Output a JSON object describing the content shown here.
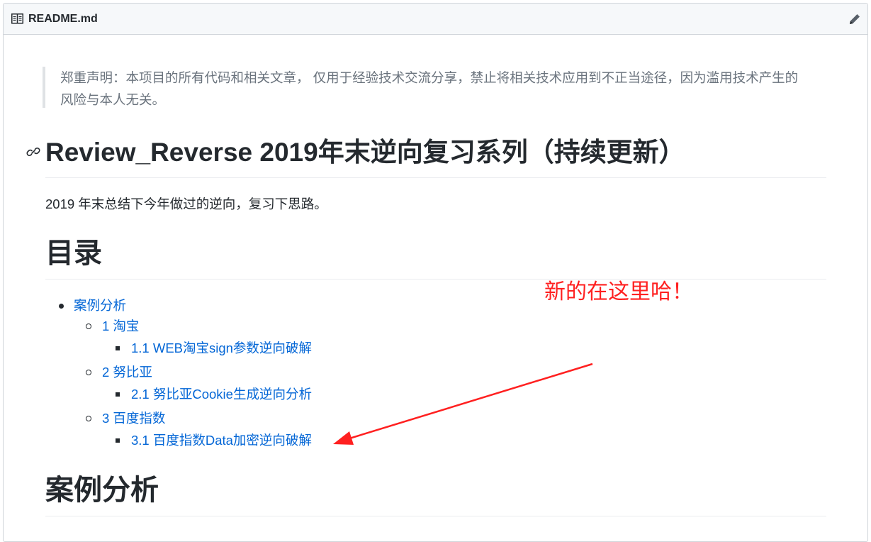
{
  "header": {
    "file_name": "README.md",
    "icon": "book-icon",
    "edit_icon": "pencil-icon"
  },
  "notice": "郑重声明：本项目的所有代码和相关文章， 仅用于经验技术交流分享，禁止将相关技术应用到不正当途径，因为滥用技术产生的风险与本人无关。",
  "title": "Review_Reverse 2019年末逆向复习系列（持续更新）",
  "intro": "2019 年末总结下今年做过的逆向，复习下思路。",
  "toc_heading": "目录",
  "toc": {
    "top": "案例分析",
    "sections": [
      {
        "label": "1 淘宝",
        "sub": "1.1 WEB淘宝sign参数逆向破解"
      },
      {
        "label": "2 努比亚",
        "sub": "2.1 努比亚Cookie生成逆向分析"
      },
      {
        "label": "3 百度指数",
        "sub": "3.1 百度指数Data加密逆向破解"
      }
    ]
  },
  "annotation": "新的在这里哈！",
  "cases_heading": "案例分析",
  "colors": {
    "link": "#0366d6",
    "annotation": "#ff2020",
    "text": "#24292e",
    "muted": "#6a737d"
  }
}
